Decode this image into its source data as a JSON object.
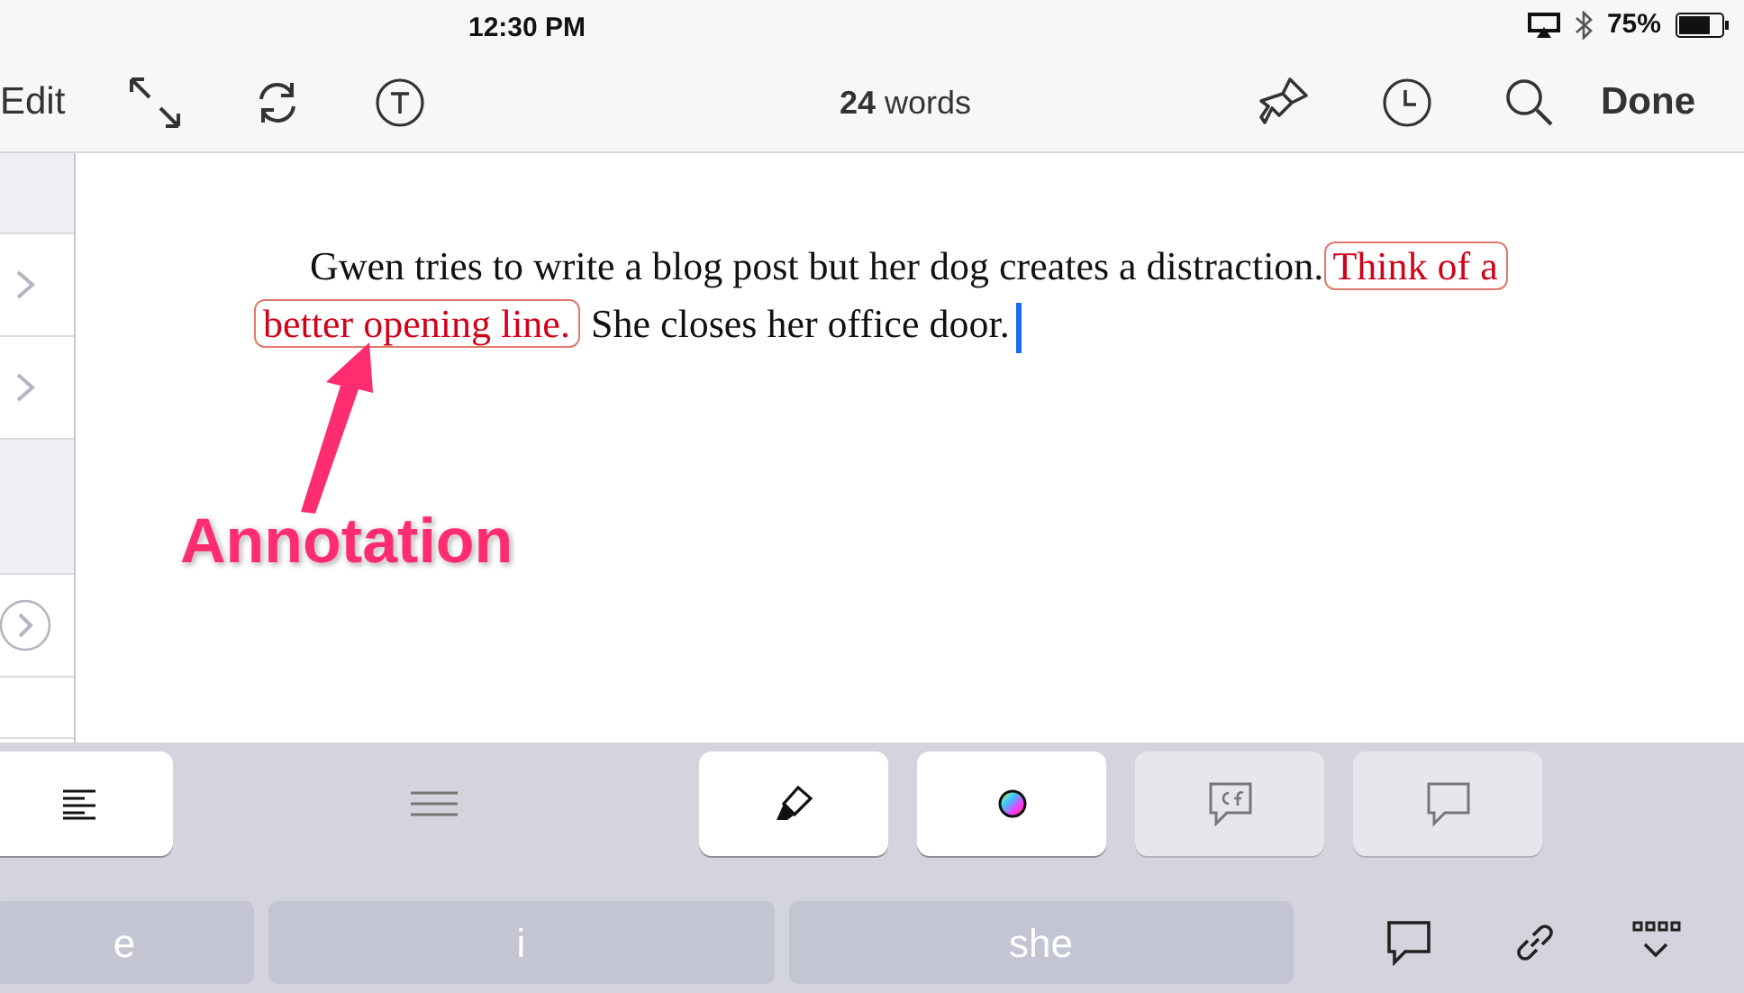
{
  "status_bar": {
    "time": "12:30 PM",
    "battery": "75%"
  },
  "toolbar": {
    "left": "Edit",
    "word_count": "**24** words",
    "right": "Done"
  },
  "sidebar": {
    "items": [
      {
        "kind": "header"
      },
      {
        "kind": "chevron"
      },
      {
        "kind": "chevron"
      },
      {
        "kind": "header"
      },
      {
        "kind": "circle"
      },
      {
        "kind": "blank"
      }
    ]
  },
  "document": {
    "segments": [
      {
        "kind": "text",
        "text": "Gwen tries to write a blog post but her dog creates a distraction."
      },
      {
        "kind": "annotation",
        "text": "Think of a"
      },
      {
        "kind": "annotation",
        "text": "better opening line."
      },
      {
        "kind": "text",
        "text": " She closes her office door."
      }
    ]
  },
  "callout": {
    "text": "Annotation"
  },
  "accessory_bar": {
    "buttons": [
      {
        "kind": "align"
      },
      {
        "kind": "menu"
      },
      {
        "kind": "highlighter"
      },
      {
        "kind": "color"
      },
      {
        "kind": "cf-comment"
      },
      {
        "kind": "comment"
      }
    ]
  },
  "suggestions": [
    "e",
    "i",
    "she"
  ]
}
